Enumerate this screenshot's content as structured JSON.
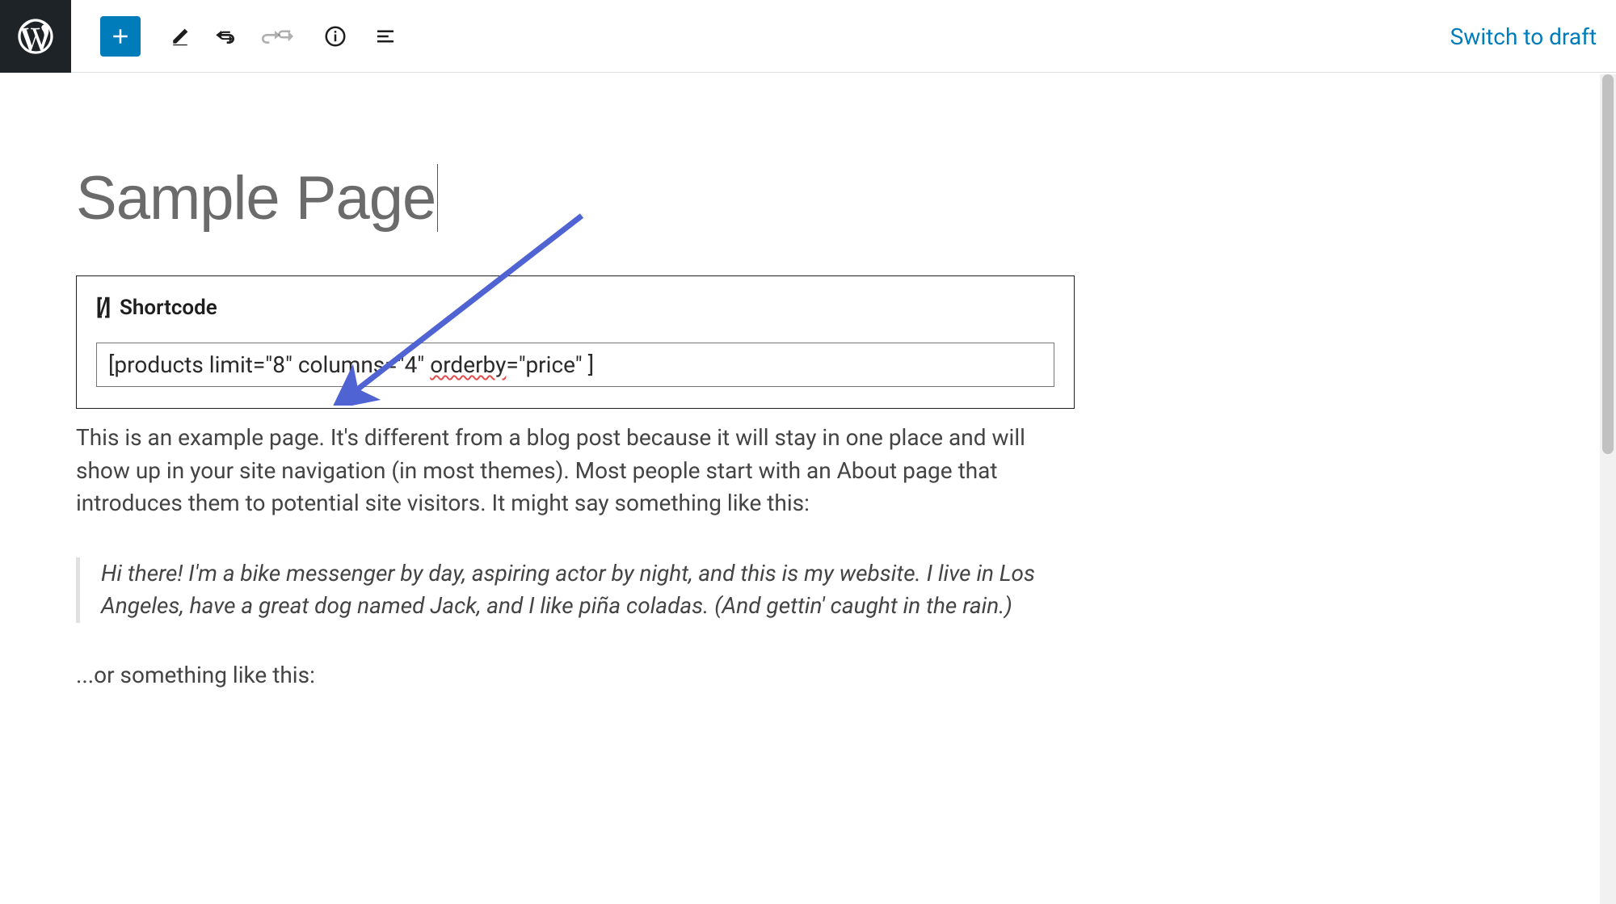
{
  "toolbar": {
    "switch_to_draft": "Switch to draft"
  },
  "page": {
    "title": "Sample Page"
  },
  "shortcode": {
    "label": "Shortcode",
    "value_pre": "[products limit=\"8\" columns=\"4\" ",
    "value_spell": "orderby",
    "value_post": "=\"price\" ]"
  },
  "paragraphs": {
    "intro": "This is an example page. It's different from a blog post because it will stay in one place and will show up in your site navigation (in most themes). Most people start with an About page that introduces them to potential site visitors. It might say something like this:",
    "quote": "Hi there! I'm a bike messenger by day, aspiring actor by night, and this is my website. I live in Los Angeles, have a great dog named Jack, and I like piña coladas. (And gettin' caught in the rain.)",
    "after": "...or something like this:"
  }
}
